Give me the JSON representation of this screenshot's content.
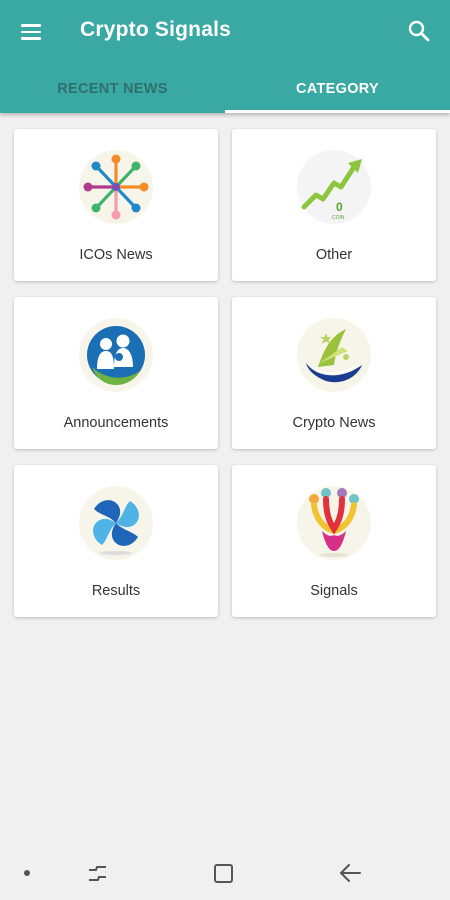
{
  "app_bar": {
    "title": "Crypto Signals",
    "menu_icon": "hamburger-menu-icon",
    "search_icon": "search-icon",
    "color": "#3aa9a4"
  },
  "tabs": [
    {
      "label": "RECENT NEWS",
      "selected": false
    },
    {
      "label": "CATEGORY",
      "selected": true
    }
  ],
  "categories": [
    {
      "label": "ICOs News",
      "icon": "people-circle-icon"
    },
    {
      "label": "Other",
      "icon": "growth-chart-icon"
    },
    {
      "label": "Announcements",
      "icon": "family-icon"
    },
    {
      "label": "Crypto News",
      "icon": "hand-star-icon"
    },
    {
      "label": "Results",
      "icon": "swirl-icon"
    },
    {
      "label": "Signals",
      "icon": "figures-heart-icon"
    }
  ],
  "other_icon_text": {
    "number": "0",
    "caption": "COIN"
  },
  "system_nav": {
    "icons": [
      "nav-dot-icon",
      "recent-apps-icon",
      "home-icon",
      "back-icon"
    ]
  }
}
